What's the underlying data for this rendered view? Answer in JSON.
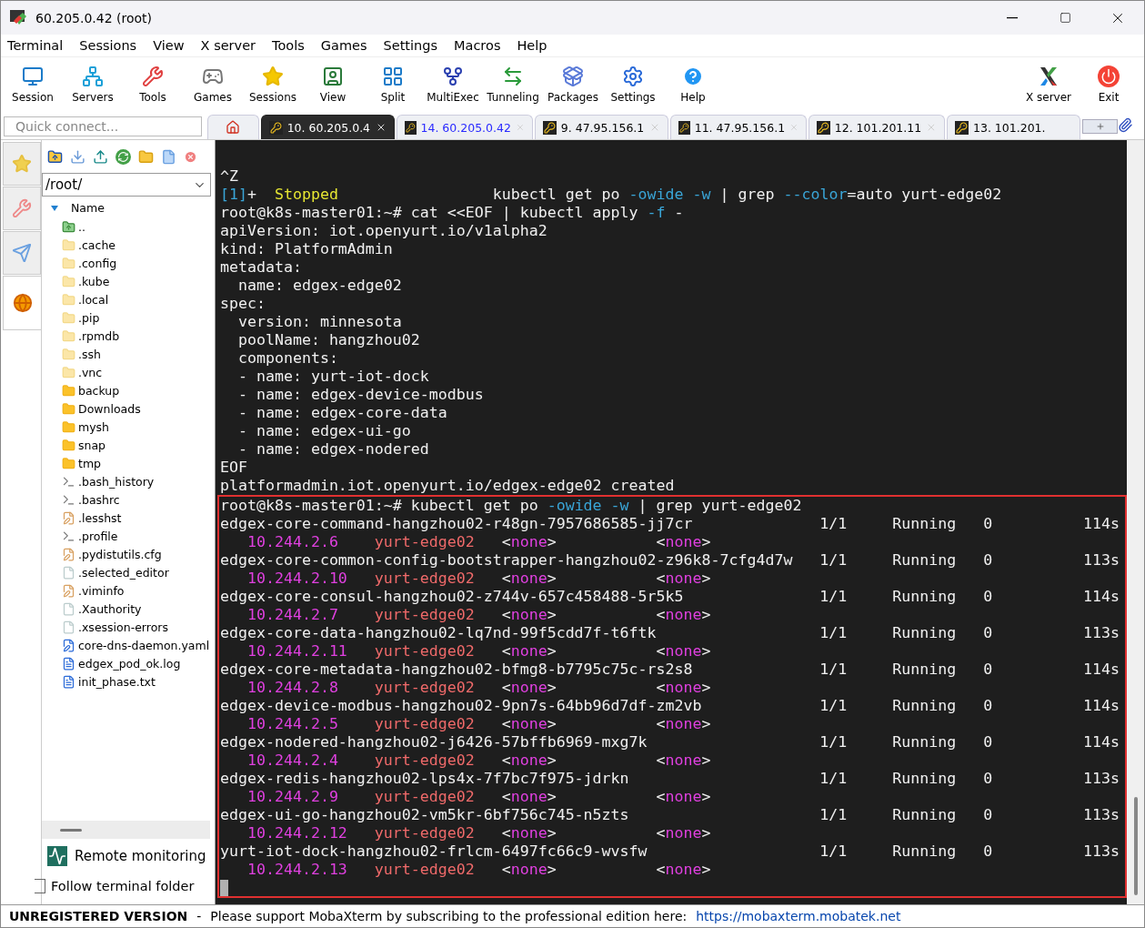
{
  "window": {
    "title": "60.205.0.42 (root)"
  },
  "menu": [
    "Terminal",
    "Sessions",
    "View",
    "X server",
    "Tools",
    "Games",
    "Settings",
    "Macros",
    "Help"
  ],
  "toolbar": {
    "left": [
      "Session",
      "Servers",
      "Tools",
      "Games",
      "Sessions",
      "View",
      "Split",
      "MultiExec",
      "Tunneling",
      "Packages",
      "Settings",
      "Help"
    ],
    "right": [
      "X server",
      "Exit"
    ]
  },
  "quick_connect": {
    "placeholder": "Quick connect..."
  },
  "tabs": [
    {
      "label": "10. 60.205.0.4",
      "selected": true
    },
    {
      "label": "14. 60.205.0.42",
      "selected": false,
      "color": "#2a2aff"
    },
    {
      "label": "9. 47.95.156.1",
      "selected": false,
      "color": "#000000"
    },
    {
      "label": "11. 47.95.156.1",
      "selected": false,
      "color": "#000000"
    },
    {
      "label": "12. 101.201.11",
      "selected": false,
      "color": "#000000"
    },
    {
      "label": "13. 101.201.",
      "selected": false,
      "color": "#000000"
    }
  ],
  "sidebar": {
    "side_tabs": [
      {
        "selected": false
      },
      {
        "selected": false
      },
      {
        "selected": false
      },
      {
        "selected": true
      }
    ],
    "path": "/root/",
    "column": "Name",
    "files": [
      {
        "name": "..",
        "kind": "up"
      },
      {
        "name": ".cache",
        "kind": "hidden-folder"
      },
      {
        "name": ".config",
        "kind": "hidden-folder"
      },
      {
        "name": ".kube",
        "kind": "hidden-folder"
      },
      {
        "name": ".local",
        "kind": "hidden-folder"
      },
      {
        "name": ".pip",
        "kind": "hidden-folder"
      },
      {
        "name": ".rpmdb",
        "kind": "hidden-folder"
      },
      {
        "name": ".ssh",
        "kind": "hidden-folder"
      },
      {
        "name": ".vnc",
        "kind": "hidden-folder"
      },
      {
        "name": "backup",
        "kind": "folder"
      },
      {
        "name": "Downloads",
        "kind": "folder"
      },
      {
        "name": "mysh",
        "kind": "folder"
      },
      {
        "name": "snap",
        "kind": "folder"
      },
      {
        "name": "tmp",
        "kind": "folder"
      },
      {
        "name": ".bash_history",
        "kind": "shell"
      },
      {
        "name": ".bashrc",
        "kind": "shell"
      },
      {
        "name": ".lesshst",
        "kind": "edit"
      },
      {
        "name": ".profile",
        "kind": "shell"
      },
      {
        "name": ".pydistutils.cfg",
        "kind": "edit"
      },
      {
        "name": ".selected_editor",
        "kind": "blank"
      },
      {
        "name": ".viminfo",
        "kind": "edit"
      },
      {
        "name": ".Xauthority",
        "kind": "blank"
      },
      {
        "name": ".xsession-errors",
        "kind": "blank"
      },
      {
        "name": "core-dns-daemon.yaml",
        "kind": "yaml"
      },
      {
        "name": "edgex_pod_ok.log",
        "kind": "log"
      },
      {
        "name": "init_phase.txt",
        "kind": "log"
      }
    ],
    "remote_monitoring": "Remote monitoring",
    "follow_folder": {
      "label": "Follow terminal folder",
      "checked": false
    }
  },
  "terminal": {
    "lines": [
      [
        {
          "t": "^Z"
        }
      ],
      [
        {
          "t": "[1]",
          "color": "#3aa6d8"
        },
        {
          "t": "+  "
        },
        {
          "t": "Stopped",
          "color": "#e6e632"
        },
        {
          "t": "                 kubectl get po "
        },
        {
          "t": "-owide",
          "color": "#3aa6d8"
        },
        {
          "t": " -w",
          "color": "#3aa6d8"
        },
        {
          "t": " | grep "
        },
        {
          "t": "--color",
          "color": "#3aa6d8"
        },
        {
          "t": "=auto yurt-edge02"
        }
      ],
      [
        {
          "t": "root@k8s-master01:~# cat <<EOF | kubectl apply "
        },
        {
          "t": "-f",
          "color": "#3aa6d8"
        },
        {
          "t": " -"
        }
      ],
      [
        {
          "t": "apiVersion: iot.openyurt.io/v1alpha2"
        }
      ],
      [
        {
          "t": "kind: PlatformAdmin"
        }
      ],
      [
        {
          "t": "metadata:"
        }
      ],
      [
        {
          "t": "  name: edgex-edge02"
        }
      ],
      [
        {
          "t": "spec:"
        }
      ],
      [
        {
          "t": "  version: minnesota"
        }
      ],
      [
        {
          "t": "  poolName: hangzhou02"
        }
      ],
      [
        {
          "t": "  components:"
        }
      ],
      [
        {
          "t": "  - name: yurt-iot-dock"
        }
      ],
      [
        {
          "t": "  - name: edgex-device-modbus"
        }
      ],
      [
        {
          "t": "  - name: edgex-core-data"
        }
      ],
      [
        {
          "t": "  - name: edgex-ui-go"
        }
      ],
      [
        {
          "t": "  - name: edgex-nodered"
        }
      ],
      [
        {
          "t": "EOF"
        }
      ],
      [
        {
          "t": "platformadmin.iot.openyurt.io/edgex-edge02 created"
        }
      ]
    ],
    "highlight": {
      "command": [
        {
          "t": "root@k8s-master01:~# kubectl get po "
        },
        {
          "t": "-owide",
          "color": "#3aa6d8"
        },
        {
          "t": " -w",
          "color": "#3aa6d8"
        },
        {
          "t": " | grep yurt-edge02"
        }
      ],
      "pods": [
        {
          "name": "edgex-core-command-hangzhou02-r48gn-7957686585-jj7cr",
          "ready": "1/1",
          "status": "Running",
          "restarts": "0",
          "age": "114s",
          "ip": "10.244.2.6",
          "node": "yurt-edge02",
          "nominated": "<none>",
          "gates": "<none>"
        },
        {
          "name": "edgex-core-common-config-bootstrapper-hangzhou02-z96k8-7cfg4d7w",
          "ready": "1/1",
          "status": "Running",
          "restarts": "0",
          "age": "113s",
          "ip": "10.244.2.10",
          "node": "yurt-edge02",
          "nominated": "<none>",
          "gates": "<none>"
        },
        {
          "name": "edgex-core-consul-hangzhou02-z744v-657c458488-5r5k5",
          "ready": "1/1",
          "status": "Running",
          "restarts": "0",
          "age": "114s",
          "ip": "10.244.2.7",
          "node": "yurt-edge02",
          "nominated": "<none>",
          "gates": "<none>"
        },
        {
          "name": "edgex-core-data-hangzhou02-lq7nd-99f5cdd7f-t6ftk",
          "ready": "1/1",
          "status": "Running",
          "restarts": "0",
          "age": "113s",
          "ip": "10.244.2.11",
          "node": "yurt-edge02",
          "nominated": "<none>",
          "gates": "<none>"
        },
        {
          "name": "edgex-core-metadata-hangzhou02-bfmg8-b7795c75c-rs2s8",
          "ready": "1/1",
          "status": "Running",
          "restarts": "0",
          "age": "114s",
          "ip": "10.244.2.8",
          "node": "yurt-edge02",
          "nominated": "<none>",
          "gates": "<none>"
        },
        {
          "name": "edgex-device-modbus-hangzhou02-9pn7s-64bb96d7df-zm2vb",
          "ready": "1/1",
          "status": "Running",
          "restarts": "0",
          "age": "114s",
          "ip": "10.244.2.5",
          "node": "yurt-edge02",
          "nominated": "<none>",
          "gates": "<none>"
        },
        {
          "name": "edgex-nodered-hangzhou02-j6426-57bffb6969-mxg7k",
          "ready": "1/1",
          "status": "Running",
          "restarts": "0",
          "age": "114s",
          "ip": "10.244.2.4",
          "node": "yurt-edge02",
          "nominated": "<none>",
          "gates": "<none>"
        },
        {
          "name": "edgex-redis-hangzhou02-lps4x-7f7bc7f975-jdrkn",
          "ready": "1/1",
          "status": "Running",
          "restarts": "0",
          "age": "113s",
          "ip": "10.244.2.9",
          "node": "yurt-edge02",
          "nominated": "<none>",
          "gates": "<none>"
        },
        {
          "name": "edgex-ui-go-hangzhou02-vm5kr-6bf756c745-n5zts",
          "ready": "1/1",
          "status": "Running",
          "restarts": "0",
          "age": "113s",
          "ip": "10.244.2.12",
          "node": "yurt-edge02",
          "nominated": "<none>",
          "gates": "<none>"
        },
        {
          "name": "yurt-iot-dock-hangzhou02-frlcm-6497fc66c9-wvsfw",
          "ready": "1/1",
          "status": "Running",
          "restarts": "0",
          "age": "113s",
          "ip": "10.244.2.13",
          "node": "yurt-edge02",
          "nominated": "<none>",
          "gates": "<none>"
        }
      ],
      "cursor": true
    }
  },
  "status_bar": {
    "edition": "UNREGISTERED VERSION",
    "separator": "-",
    "message": "Please support MobaXterm by subscribing to the professional edition here:",
    "link": "https://mobaxterm.mobatek.net"
  }
}
